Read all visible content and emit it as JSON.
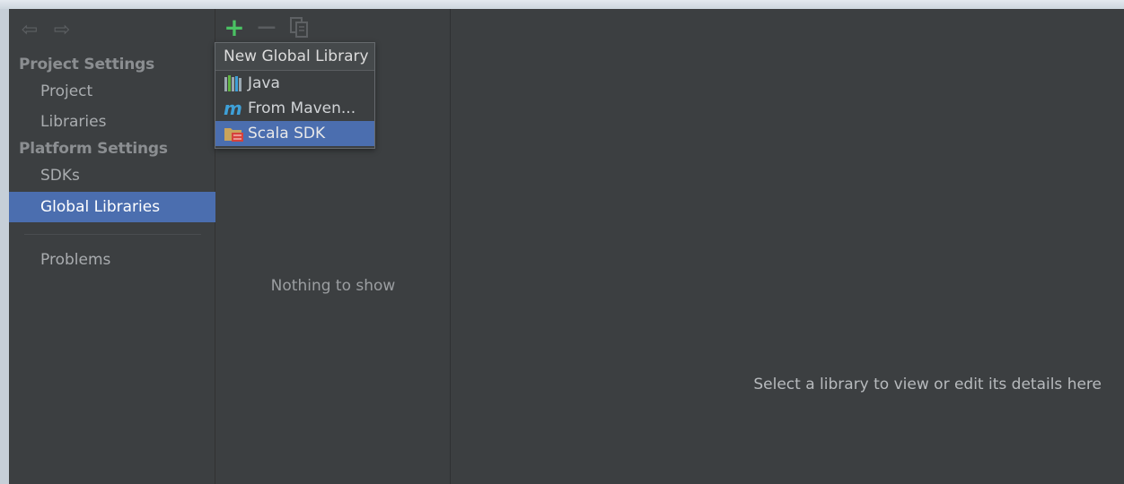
{
  "nav": {
    "back_icon": "arrow-left-icon",
    "forward_icon": "arrow-right-icon",
    "groups": {
      "project_settings": "Project Settings",
      "platform_settings": "Platform Settings"
    },
    "items": {
      "project": "Project",
      "libraries": "Libraries",
      "sdks": "SDKs",
      "global_libraries": "Global Libraries",
      "problems": "Problems"
    },
    "selected": "Global Libraries"
  },
  "toolbar": {
    "add_icon": "plus-icon",
    "remove_icon": "minus-icon",
    "copy_icon": "copy-icon"
  },
  "list": {
    "empty_text": "Nothing to show"
  },
  "popup": {
    "title": "New Global Library",
    "items": [
      {
        "label": "Java",
        "icon": "java-library-icon"
      },
      {
        "label": "From Maven...",
        "icon": "maven-icon"
      },
      {
        "label": "Scala SDK",
        "icon": "scala-sdk-icon"
      }
    ],
    "highlighted": "Scala SDK"
  },
  "detail": {
    "placeholder": "Select a library to view or edit its details here"
  },
  "colors": {
    "selection": "#4b6eaf",
    "background": "#3c3f41",
    "add_green": "#4ac163"
  }
}
